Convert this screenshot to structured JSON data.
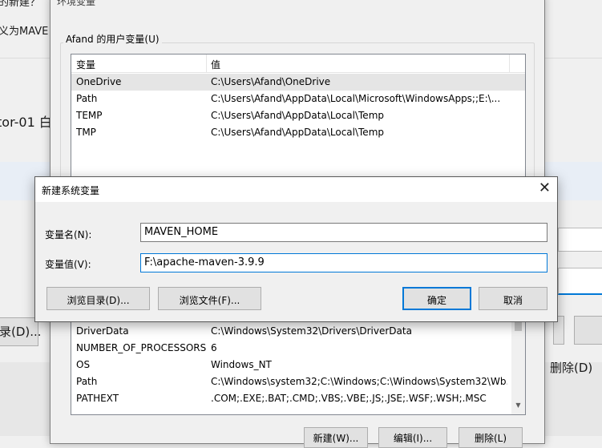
{
  "background_window": {
    "fragment_top": "的新建？",
    "fragment_maven": "义为MAVE",
    "fragment_tor": "tor-01 白",
    "fragment_browse": "录(D)...",
    "fragment_delete": "删除(D)"
  },
  "env_dialog": {
    "title": "环境变量",
    "close_glyph": "✕",
    "user_group_label": "Afand 的用户变量(U)",
    "user_list": {
      "col_name": "变量",
      "col_value": "值",
      "rows": [
        {
          "name": "OneDrive",
          "value": "C:\\Users\\Afand\\OneDrive"
        },
        {
          "name": "Path",
          "value": "C:\\Users\\Afand\\AppData\\Local\\Microsoft\\WindowsApps;;E:\\..."
        },
        {
          "name": "TEMP",
          "value": "C:\\Users\\Afand\\AppData\\Local\\Temp"
        },
        {
          "name": "TMP",
          "value": "C:\\Users\\Afand\\AppData\\Local\\Temp"
        }
      ]
    },
    "system_list": {
      "rows": [
        {
          "name": "DriverData",
          "value": "C:\\Windows\\System32\\Drivers\\DriverData"
        },
        {
          "name": "NUMBER_OF_PROCESSORS",
          "value": "6"
        },
        {
          "name": "OS",
          "value": "Windows_NT"
        },
        {
          "name": "Path",
          "value": "C:\\Windows\\system32;C:\\Windows;C:\\Windows\\System32\\Wb..."
        },
        {
          "name": "PATHEXT",
          "value": ".COM;.EXE;.BAT;.CMD;.VBS;.VBE;.JS;.JSE;.WSF;.WSH;.MSC"
        }
      ]
    },
    "buttons": {
      "new": "新建(W)...",
      "edit": "编辑(I)...",
      "delete": "删除(L)"
    }
  },
  "new_var_dialog": {
    "title": "新建系统变量",
    "close_glyph": "✕",
    "name_label": "变量名(N):",
    "name_value": "MAVEN_HOME",
    "value_label": "变量值(V):",
    "value_value": "F:\\apache-maven-3.9.9",
    "browse_dir_button": "浏览目录(D)...",
    "browse_file_button": "浏览文件(F)...",
    "ok_button": "确定",
    "cancel_button": "取消"
  },
  "colors": {
    "accent": "#0078d7",
    "dialog_bg": "#f0f0f0",
    "selected_row": "#e5e5e5"
  }
}
